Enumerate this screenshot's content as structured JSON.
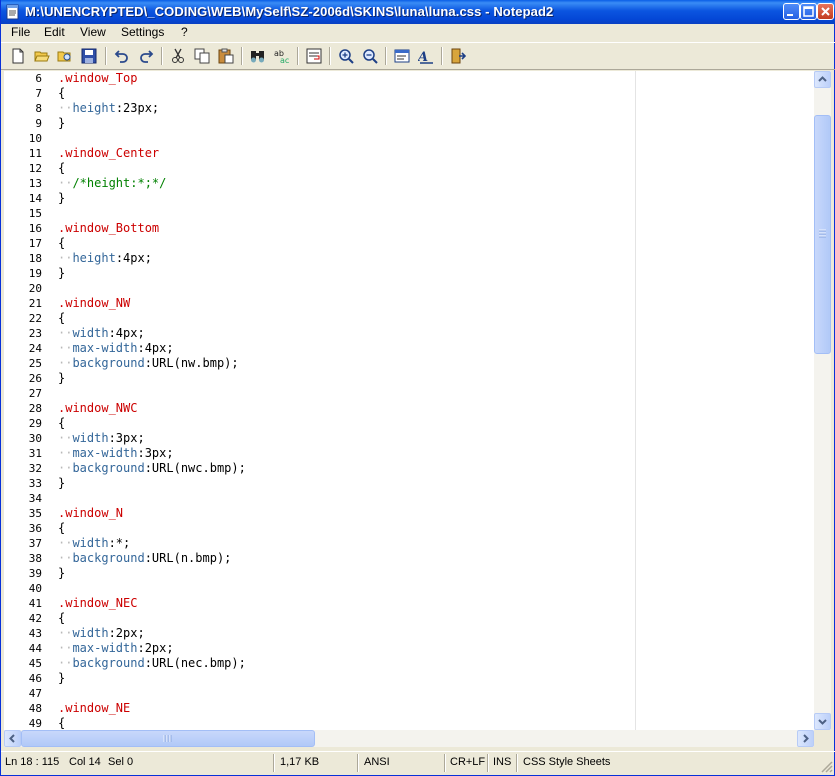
{
  "window": {
    "title": "M:\\UNENCRYPTED\\_CODING\\WEB\\MySelf\\SZ-2006d\\SKINS\\luna\\luna.css - Notepad2"
  },
  "menu": [
    {
      "label": "File"
    },
    {
      "label": "Edit"
    },
    {
      "label": "View"
    },
    {
      "label": "Settings"
    },
    {
      "label": "?"
    }
  ],
  "toolbar": {
    "icons": [
      "new-file-icon",
      "open-folder-icon",
      "browse-icon",
      "save-icon",
      "undo-icon",
      "redo-icon",
      "cut-icon",
      "copy-icon",
      "paste-icon",
      "find-icon",
      "replace-icon",
      "word-wrap-icon",
      "zoom-in-icon",
      "zoom-out-icon",
      "scheme-icon",
      "customize-scheme-icon",
      "exit-icon"
    ]
  },
  "editor": {
    "lines": [
      {
        "n": "6",
        "text": ".window_Top",
        "kind": "selector"
      },
      {
        "n": "7",
        "text": "{",
        "kind": "brace"
      },
      {
        "n": "8",
        "indent": "··",
        "prop": "height",
        "value": ":23px;",
        "kind": "decl"
      },
      {
        "n": "9",
        "text": "}",
        "kind": "brace"
      },
      {
        "n": "10",
        "text": "",
        "kind": "empty"
      },
      {
        "n": "11",
        "text": ".window_Center",
        "kind": "selector"
      },
      {
        "n": "12",
        "text": "{",
        "kind": "brace"
      },
      {
        "n": "13",
        "indent": "··",
        "text": "/*height:*;*/",
        "kind": "comment"
      },
      {
        "n": "14",
        "text": "}",
        "kind": "brace"
      },
      {
        "n": "15",
        "text": "",
        "kind": "empty"
      },
      {
        "n": "16",
        "text": ".window_Bottom",
        "kind": "selector"
      },
      {
        "n": "17",
        "text": "{",
        "kind": "brace"
      },
      {
        "n": "18",
        "indent": "··",
        "prop": "height",
        "value": ":4px;",
        "kind": "decl"
      },
      {
        "n": "19",
        "text": "}",
        "kind": "brace"
      },
      {
        "n": "20",
        "text": "",
        "kind": "empty"
      },
      {
        "n": "21",
        "text": ".window_NW",
        "kind": "selector"
      },
      {
        "n": "22",
        "text": "{",
        "kind": "brace"
      },
      {
        "n": "23",
        "indent": "··",
        "prop": "width",
        "value": ":4px;",
        "kind": "decl"
      },
      {
        "n": "24",
        "indent": "··",
        "prop": "max-width",
        "value": ":4px;",
        "kind": "decl"
      },
      {
        "n": "25",
        "indent": "··",
        "prop": "background",
        "value": ":URL(nw.bmp);",
        "kind": "decl"
      },
      {
        "n": "26",
        "text": "}",
        "kind": "brace"
      },
      {
        "n": "27",
        "text": "",
        "kind": "empty"
      },
      {
        "n": "28",
        "text": ".window_NWC",
        "kind": "selector"
      },
      {
        "n": "29",
        "text": "{",
        "kind": "brace"
      },
      {
        "n": "30",
        "indent": "··",
        "prop": "width",
        "value": ":3px;",
        "kind": "decl"
      },
      {
        "n": "31",
        "indent": "··",
        "prop": "max-width",
        "value": ":3px;",
        "kind": "decl"
      },
      {
        "n": "32",
        "indent": "··",
        "prop": "background",
        "value": ":URL(nwc.bmp);",
        "kind": "decl"
      },
      {
        "n": "33",
        "text": "}",
        "kind": "brace"
      },
      {
        "n": "34",
        "text": "",
        "kind": "empty"
      },
      {
        "n": "35",
        "text": ".window_N",
        "kind": "selector"
      },
      {
        "n": "36",
        "text": "{",
        "kind": "brace"
      },
      {
        "n": "37",
        "indent": "··",
        "prop": "width",
        "value": ":*;",
        "kind": "decl"
      },
      {
        "n": "38",
        "indent": "··",
        "prop": "background",
        "value": ":URL(n.bmp);",
        "kind": "decl"
      },
      {
        "n": "39",
        "text": "}",
        "kind": "brace"
      },
      {
        "n": "40",
        "text": "",
        "kind": "empty"
      },
      {
        "n": "41",
        "text": ".window_NEC",
        "kind": "selector"
      },
      {
        "n": "42",
        "text": "{",
        "kind": "brace"
      },
      {
        "n": "43",
        "indent": "··",
        "prop": "width",
        "value": ":2px;",
        "kind": "decl"
      },
      {
        "n": "44",
        "indent": "··",
        "prop": "max-width",
        "value": ":2px;",
        "kind": "decl"
      },
      {
        "n": "45",
        "indent": "··",
        "prop": "background",
        "value": ":URL(nec.bmp);",
        "kind": "decl"
      },
      {
        "n": "46",
        "text": "}",
        "kind": "brace"
      },
      {
        "n": "47",
        "text": "",
        "kind": "empty"
      },
      {
        "n": "48",
        "text": ".window_NE",
        "kind": "selector"
      },
      {
        "n": "49",
        "text": "{",
        "kind": "brace"
      }
    ]
  },
  "status": {
    "position": "Ln 18 : 115",
    "column": "Col 14",
    "selection": "Sel 0",
    "size": "1,17 KB",
    "encoding": "ANSI",
    "line_endings": "CR+LF",
    "insert_mode": "INS",
    "scheme": "CSS Style Sheets"
  },
  "colors": {
    "selector": "#cc0000",
    "property": "#336699",
    "comment": "#008000",
    "whitespace": "#b8b8b8"
  }
}
